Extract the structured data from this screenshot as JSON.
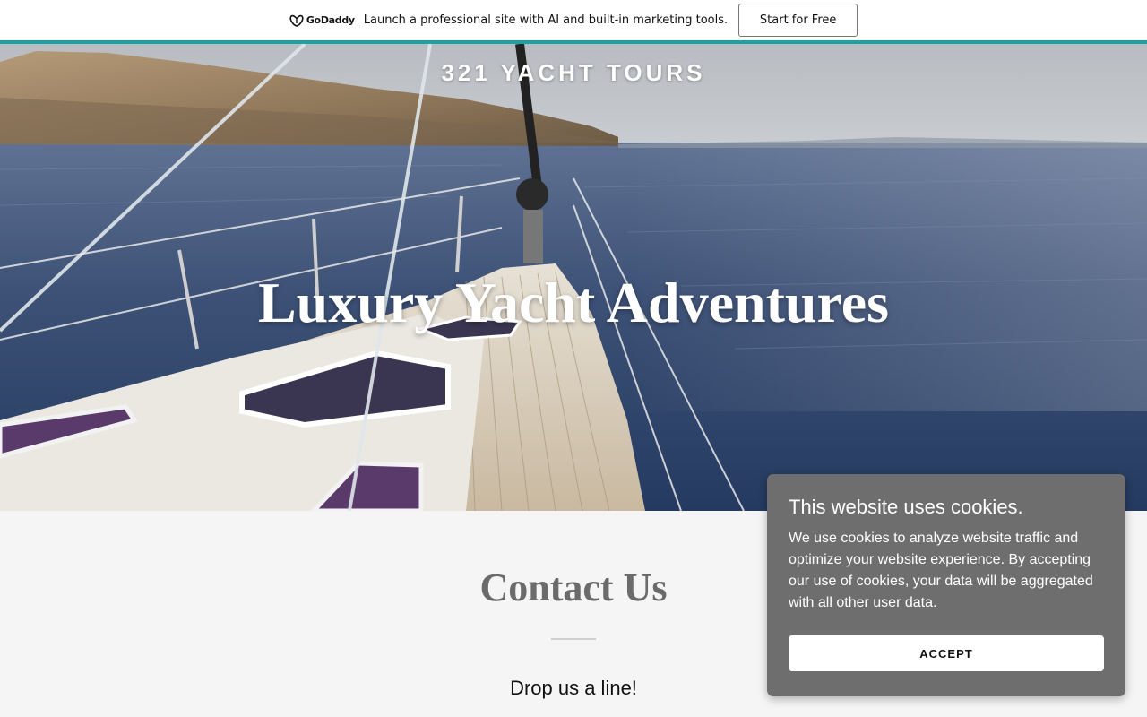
{
  "promo": {
    "logo_text": "GoDaddy",
    "message": "Launch a professional site with AI and built-in marketing tools.",
    "cta_label": "Start for Free",
    "accent_color": "#1ba3a3"
  },
  "hero": {
    "brand": "321 YACHT TOURS",
    "title": "Luxury Yacht Adventures"
  },
  "contact": {
    "title": "Contact Us",
    "subtitle": "Drop us a line!"
  },
  "cookie_banner": {
    "title": "This website uses cookies.",
    "body": "We use cookies to analyze website traffic and optimize your website experience. By accepting our use of cookies, your data will be aggregated with all other user data.",
    "accept_label": "ACCEPT",
    "background_color": "#6e6e6e"
  }
}
